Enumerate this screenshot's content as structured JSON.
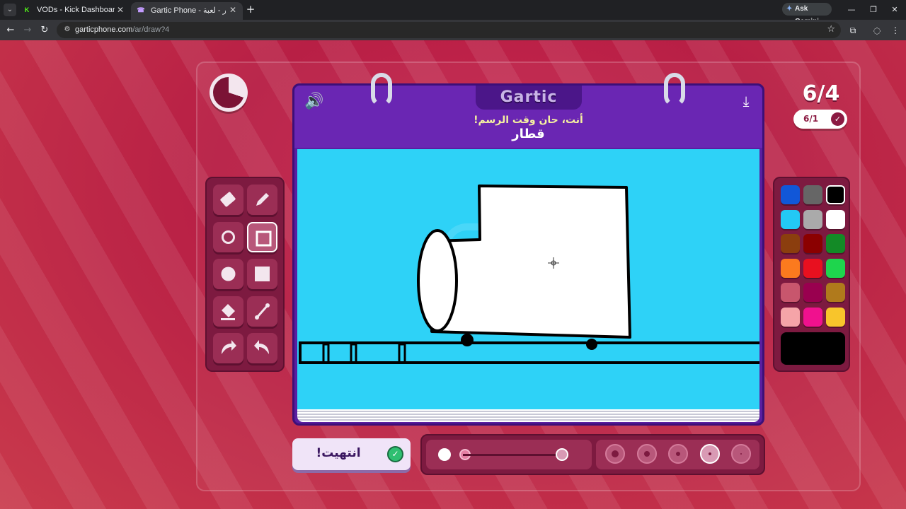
{
  "browser": {
    "tabs": [
      {
        "title": "VODs - Kick Dashboard",
        "favicon": "kick-icon",
        "color": "#53fc18"
      },
      {
        "title": "Gartic Phone - الهاتف المكسور - لعبة",
        "favicon": "gartic-icon",
        "color": "#8a4fd6"
      }
    ],
    "ask_gemini": "Ask Gemini",
    "url_domain": "garticphone.com",
    "url_path": "/ar/draw?4"
  },
  "game": {
    "logo": "Gartic",
    "instruction": "أنت، حان وقت الرسم!",
    "word": "قطار",
    "counter": "6/4",
    "rounds": "6/1",
    "done_label": "انتهيت!",
    "timer_remaining_fraction": 0.7
  },
  "tools": [
    {
      "name": "eraser-icon",
      "active": false
    },
    {
      "name": "pencil-icon",
      "active": false
    },
    {
      "name": "ellipse-outline-icon",
      "active": false
    },
    {
      "name": "rectangle-outline-icon",
      "active": true
    },
    {
      "name": "ellipse-filled-icon",
      "active": false
    },
    {
      "name": "rectangle-filled-icon",
      "active": false
    },
    {
      "name": "fill-bucket-icon",
      "active": false
    },
    {
      "name": "line-icon",
      "active": false
    },
    {
      "name": "undo-icon",
      "active": false
    },
    {
      "name": "redo-icon",
      "active": false
    }
  ],
  "palette": {
    "colors": [
      "#1157d8",
      "#666666",
      "#000000",
      "#23c9f5",
      "#aaaaaa",
      "#ffffff",
      "#8b3e0e",
      "#8b0000",
      "#138a26",
      "#fb7a1e",
      "#e8101f",
      "#1ed54d",
      "#c8566d",
      "#99004f",
      "#b07a1c",
      "#f5a4a8",
      "#f0118e",
      "#f8c52b"
    ],
    "selected_index": 2,
    "current_color": "#000000"
  },
  "brush": {
    "opacity_fraction": 1.0,
    "size_options": 5,
    "selected_size_index": 3
  }
}
